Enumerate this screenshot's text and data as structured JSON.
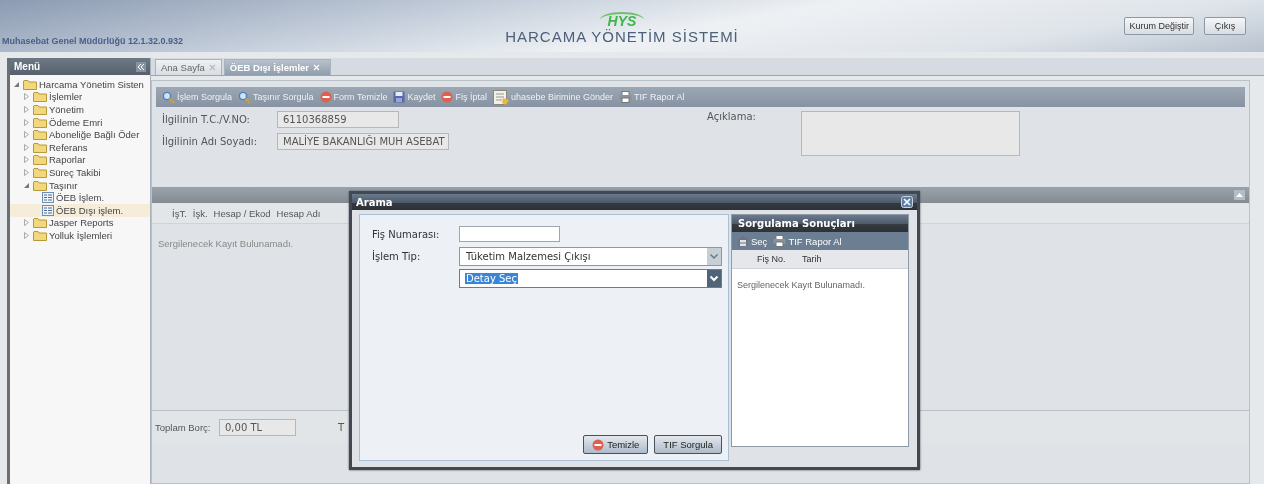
{
  "header": {
    "version_text": "Muhasebat Genel Müdürlüğü 12.1.32.0.932",
    "logo_text": "HYS",
    "system_title": "HARCAMA YÖNETİM SİSTEMİ",
    "buttons": [
      "Kurum Değiştir",
      "Çıkış"
    ]
  },
  "sidebar": {
    "title": "Menü",
    "tree": [
      {
        "label": "Harcama Yönetim Sisten",
        "kind": "folder",
        "expanded": true,
        "selected": false,
        "children": [
          {
            "label": "İşlemler",
            "kind": "folder",
            "expanded": false,
            "selected": false
          },
          {
            "label": "Yönetim",
            "kind": "folder",
            "expanded": false,
            "selected": false
          },
          {
            "label": "Ödeme Emri",
            "kind": "folder",
            "expanded": false,
            "selected": false
          },
          {
            "label": "Aboneliğe Bağlı Öder",
            "kind": "folder",
            "expanded": false,
            "selected": false
          },
          {
            "label": "Referans",
            "kind": "folder",
            "expanded": false,
            "selected": false
          },
          {
            "label": "Raporlar",
            "kind": "folder",
            "expanded": false,
            "selected": false
          },
          {
            "label": "Süreç Takibi",
            "kind": "folder",
            "expanded": false,
            "selected": false
          },
          {
            "label": "Taşınır",
            "kind": "folder",
            "expanded": true,
            "selected": false,
            "children": [
              {
                "label": "ÖEB İşlem.",
                "kind": "page",
                "selected": false
              },
              {
                "label": "ÖEB Dışı işlem.",
                "kind": "page",
                "selected": true
              }
            ]
          },
          {
            "label": "Jasper Reports",
            "kind": "folder",
            "expanded": false,
            "selected": false
          },
          {
            "label": "Yolluk İşlemleri",
            "kind": "folder",
            "expanded": false,
            "selected": false
          }
        ]
      }
    ]
  },
  "tabs": [
    {
      "label": "Ana Sayfa",
      "selected": false
    },
    {
      "label": "ÖEB Dışı İşlemler",
      "selected": true
    }
  ],
  "toolbar": [
    {
      "label": "İşlem Sorgula",
      "kind": "search"
    },
    {
      "label": "Taşınır Sorgula",
      "kind": "search"
    },
    {
      "label": "Form Temizle",
      "kind": "stop"
    },
    {
      "label": "Kaydet",
      "kind": "save"
    },
    {
      "label": "Fiş İptal",
      "kind": "stop"
    },
    {
      "label": "uhasebe Birimine Gönder",
      "kind": "send"
    },
    {
      "label": "TIF Rapor Al",
      "kind": "print"
    }
  ],
  "form": {
    "fields": [
      {
        "label": "İlgilinin T.C./V.NO:",
        "value": "6110368859"
      },
      {
        "label": "İlgilinin Adı Soyadı:",
        "value": "MALİYE BAKANLIĞI MUH ASEBAT"
      }
    ],
    "note_label": "Açıklama:"
  },
  "grid": {
    "columns": [
      "İşT.",
      "İşk.",
      "Hesap / Ekod",
      "Hesap Adı"
    ],
    "empty_text": "Sergilenecek Kayıt Bulunamadı."
  },
  "footer": {
    "label": "Toplam Borç:",
    "value": "0,00 TL",
    "label_2": "T"
  },
  "dialog": {
    "title": "Arama",
    "fields": [
      {
        "label": "Fiş Numarası:",
        "kind": "text"
      },
      {
        "label": "İşlem Tip:",
        "kind": "select",
        "value": "Tüketim Malzemesi Çıkışı",
        "focused": false
      },
      {
        "kind": "select",
        "value": "Detay Seç",
        "focused": true
      }
    ],
    "buttons": [
      {
        "label": "Temizle",
        "kind": "stop"
      },
      {
        "label": "TIF Sorgula",
        "kind": "plain"
      }
    ],
    "results": {
      "title": "Sorgulama Sonuçları",
      "toolbar": [
        {
          "label": "Seç",
          "kind": "cabinet"
        },
        {
          "label": "TIF Rapor Al",
          "kind": "print"
        }
      ],
      "columns": [
        "Fiş No.",
        "Tarih"
      ],
      "empty_text": "Sergilenecek Kayıt Bulunamadı."
    }
  }
}
